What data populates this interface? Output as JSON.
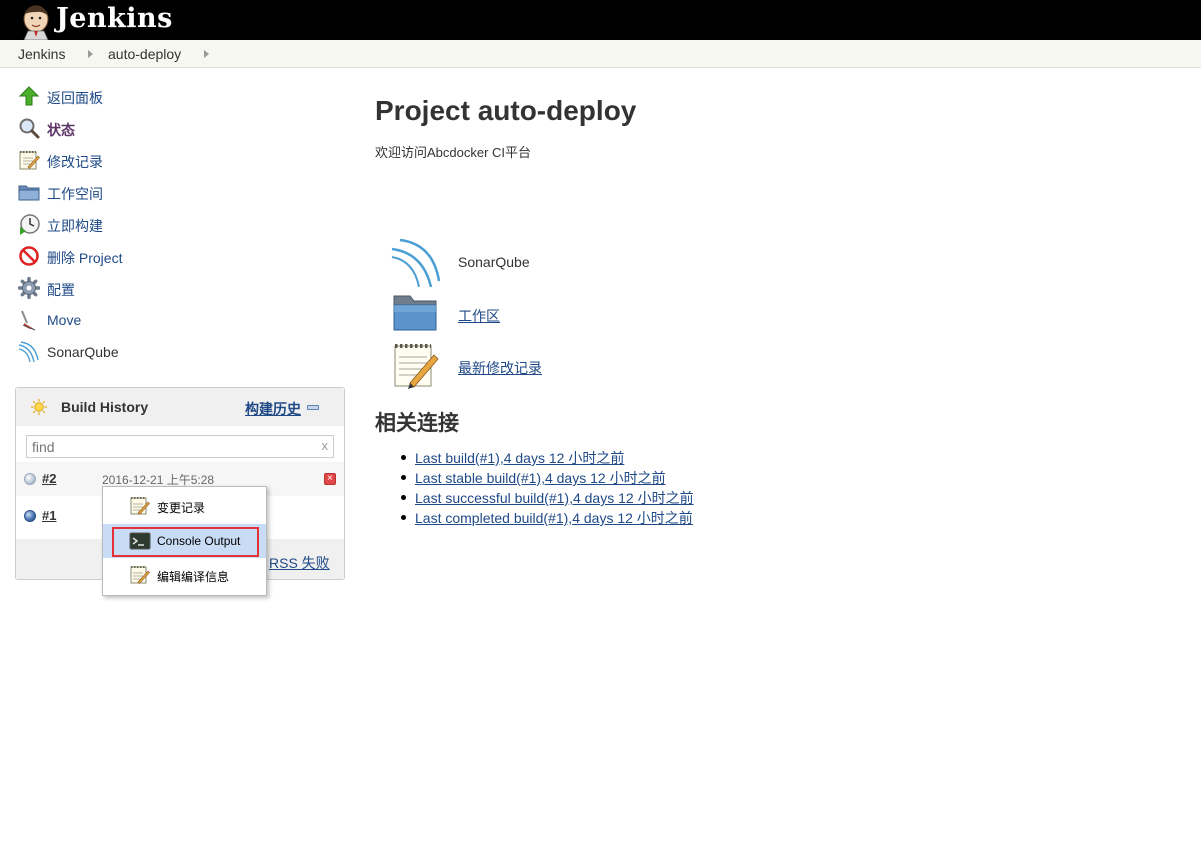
{
  "header": {
    "brand": "Jenkins"
  },
  "breadcrumb": [
    {
      "label": "Jenkins"
    },
    {
      "label": "auto-deploy"
    }
  ],
  "sidebar": {
    "tasks": [
      {
        "label": "返回面板",
        "icon": "up-arrow-icon"
      },
      {
        "label": "状态",
        "icon": "search-icon"
      },
      {
        "label": "修改记录",
        "icon": "notepad-icon"
      },
      {
        "label": "工作空间",
        "icon": "folder-icon"
      },
      {
        "label": "立即构建",
        "icon": "clock-icon"
      },
      {
        "label": "删除 Project",
        "icon": "no-entry-icon"
      },
      {
        "label": "配置",
        "icon": "gear-icon"
      },
      {
        "label": "Move",
        "icon": "move-icon"
      },
      {
        "label": "SonarQube",
        "icon": "sonarqube-icon"
      }
    ]
  },
  "build_history": {
    "title": "Build History",
    "trend_label": "构建历史",
    "search_placeholder": "find",
    "clear_label": "x",
    "builds": [
      {
        "number": "#2",
        "date": "2016-12-21 上午5:28",
        "status": "pending"
      },
      {
        "number": "#1",
        "date": "",
        "status": "success"
      }
    ],
    "rss_label": "RSS 失败"
  },
  "context_menu": {
    "items": [
      {
        "label": "变更记录",
        "icon": "notepad-icon"
      },
      {
        "label": "Console Output",
        "icon": "terminal-icon"
      },
      {
        "label": "编辑编译信息",
        "icon": "notepad-icon"
      }
    ]
  },
  "main": {
    "title": "Project auto-deploy",
    "description": "欢迎访问Abcdocker CI平台",
    "items": [
      {
        "label": "SonarQube",
        "icon": "sonarqube-icon",
        "link": false
      },
      {
        "label": "工作区",
        "icon": "folder-icon",
        "link": true
      },
      {
        "label": "最新修改记录",
        "icon": "notepad-icon",
        "link": true
      }
    ],
    "related_title": "相关连接",
    "permalinks": [
      "Last build(#1),4 days 12 小时之前",
      "Last stable build(#1),4 days 12 小时之前",
      "Last successful build(#1),4 days 12 小时之前",
      "Last completed build(#1),4 days 12 小时之前"
    ]
  },
  "colors": {
    "link": "#204A87",
    "header_bg": "#000000",
    "menu_selected": "#c9dcf5",
    "highlight_border": "#e53238"
  }
}
